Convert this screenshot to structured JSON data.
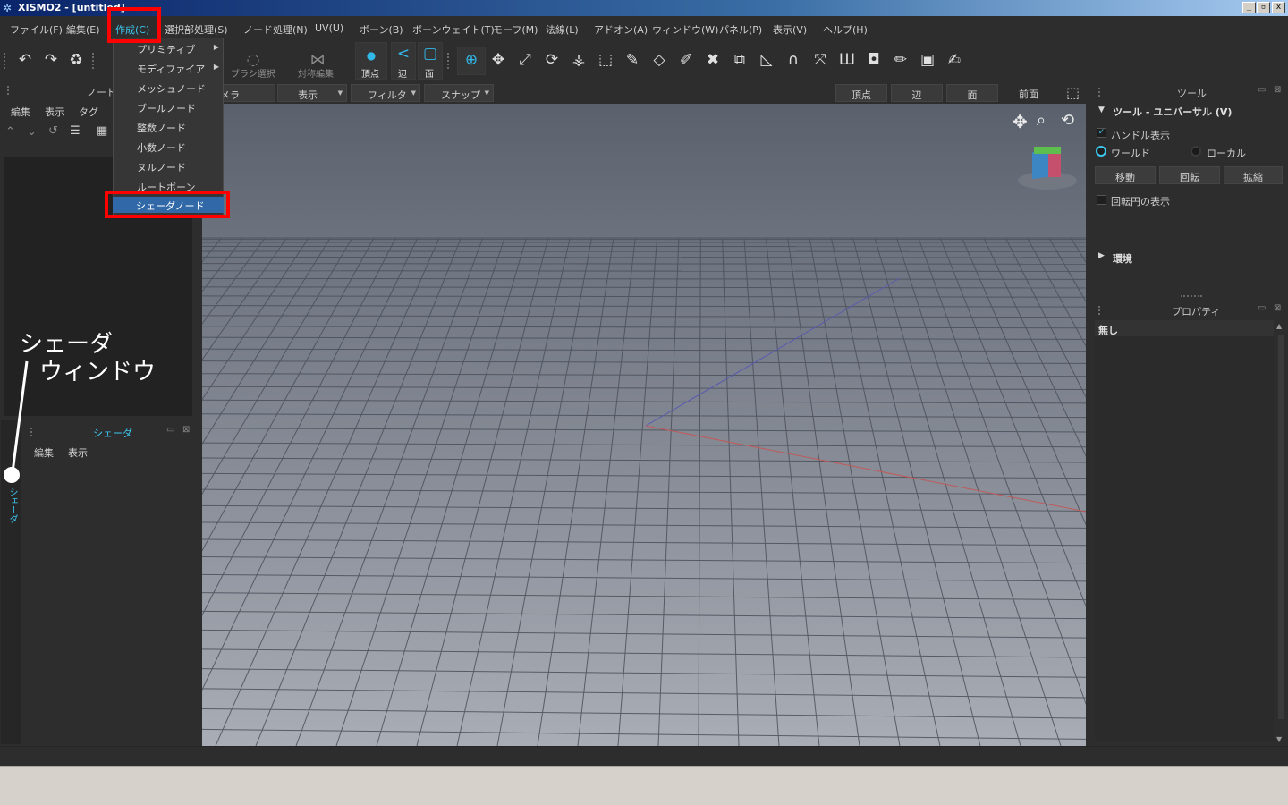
{
  "window": {
    "title": "XISMO2 - [untitled]",
    "buttons": {
      "minimize": "_",
      "restore": "▫",
      "close": "x"
    }
  },
  "menubar": [
    {
      "label": "ファイル(F)"
    },
    {
      "label": "編集(E)"
    },
    {
      "label": "作成(C)",
      "active": true
    },
    {
      "label": "選択部処理(S)"
    },
    {
      "label": "ノード処理(N)"
    },
    {
      "label": "UV(U)"
    },
    {
      "label": "ボーン(B)"
    },
    {
      "label": "ボーンウェイト(T)"
    },
    {
      "label": "モーフ(M)"
    },
    {
      "label": "法線(L)"
    },
    {
      "label": "アドオン(A)"
    },
    {
      "label": "ウィンドウ(W)"
    },
    {
      "label": "パネル(P)"
    },
    {
      "label": "表示(V)"
    },
    {
      "label": "ヘルプ(H)"
    }
  ],
  "create_menu": {
    "items": [
      {
        "label": "プリミティブ",
        "submenu": true
      },
      {
        "label": "モディファイア",
        "submenu": true
      },
      {
        "label": "メッシュノード"
      },
      {
        "label": "ブールノード"
      },
      {
        "label": "整数ノード"
      },
      {
        "label": "小数ノード"
      },
      {
        "label": "ヌルノード"
      },
      {
        "label": "ルートボーン"
      },
      {
        "label": "シェーダノード",
        "highlighted": true
      }
    ]
  },
  "toolbar": {
    "brush_select": "ブラシ選択",
    "symmetric_edit": "対称編集",
    "vertex": "頂点",
    "edge": "辺",
    "face": "面",
    "accent": "#31b9ea"
  },
  "left_panel": {
    "node_title": "ノード",
    "menu": {
      "edit": "編集",
      "view": "表示",
      "tag": "タグ"
    },
    "shader_title": "シェーダ",
    "shader_menu": {
      "edit": "編集",
      "view": "表示"
    },
    "vertical_tab": "シェーダ"
  },
  "viewport_bar": {
    "camera": "カメラ",
    "view": "表示",
    "filter": "フィルタ",
    "snap": "スナップ",
    "vertex": "頂点",
    "edge": "辺",
    "face": "面",
    "front": "前面"
  },
  "right_panel": {
    "tools_title": "ツール",
    "tool_header": "ツール - ユニバーサル (V)",
    "handle_display": "ハンドル表示",
    "world": "ワールド",
    "local": "ローカル",
    "move": "移動",
    "rotate": "回転",
    "scale": "拡縮",
    "rotation_circle": "回転円の表示",
    "environment": "環境",
    "properties_title": "プロパティ",
    "properties_value": "無し"
  },
  "annotation": {
    "line1": "シェーダ",
    "line2": "ウィンドウ"
  },
  "colors": {
    "accent": "#3cc8f0",
    "highlight": "#3068a8",
    "redbox": "#ff0000"
  }
}
